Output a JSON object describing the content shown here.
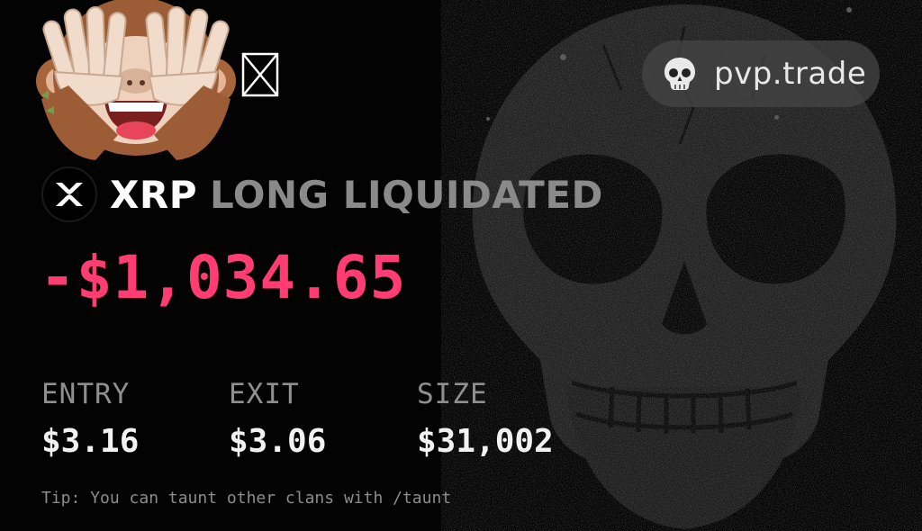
{
  "brand": {
    "name": "pvp.trade",
    "icon": "skull-icon"
  },
  "position": {
    "ticker": "XRP",
    "status": "LONG LIQUIDATED",
    "pnl": "-$1,034.65",
    "pnl_color": "#ff3d72",
    "asset_icon": "xrp-logo-icon"
  },
  "stats": {
    "entry_label": "ENTRY",
    "entry_value": "$3.16",
    "exit_label": "EXIT",
    "exit_value": "$3.06",
    "size_label": "SIZE",
    "size_value": "$31,002"
  },
  "tip": "Tip: You can taunt other clans with /taunt",
  "emoji": {
    "name": "see-no-evil-monkey"
  },
  "colors": {
    "background": "#030303",
    "label_gray": "#8f8f8f",
    "status_gray": "#8a8a8a"
  }
}
